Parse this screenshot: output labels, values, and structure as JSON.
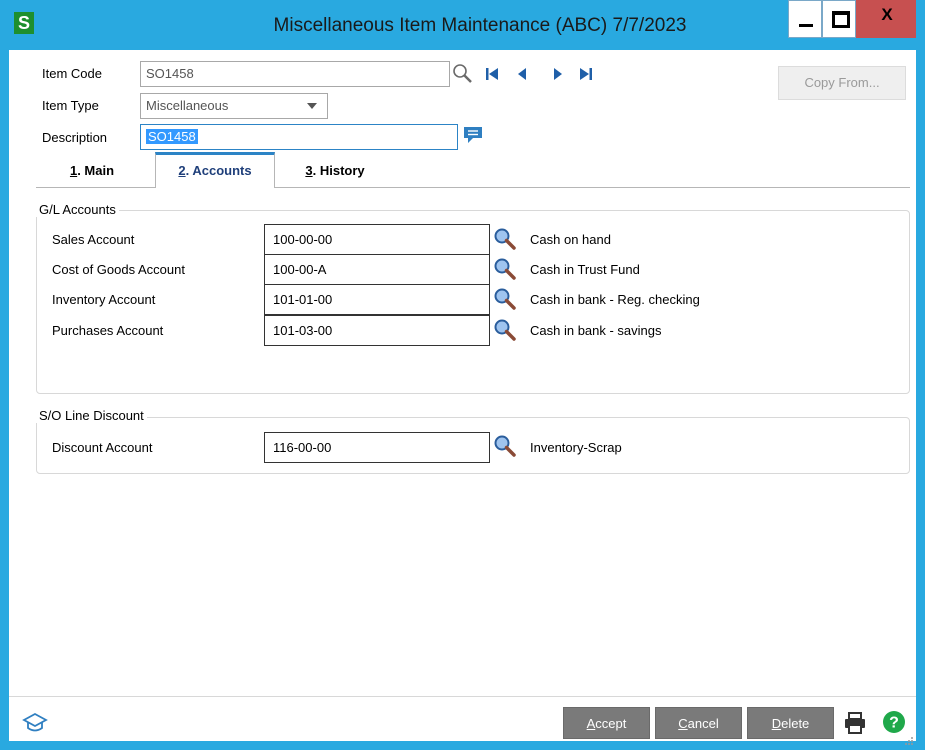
{
  "window": {
    "app_icon": "S",
    "title": "Miscellaneous Item Maintenance (ABC) 7/7/2023",
    "close_label": "X"
  },
  "header": {
    "item_code_label": "Item Code",
    "item_code_value": "SO1458",
    "item_type_label": "Item Type",
    "item_type_value": "Miscellaneous",
    "description_label": "Description",
    "description_value": "SO1458",
    "copy_from_label": "Copy From..."
  },
  "tabs": [
    {
      "num": "1",
      "label": ". Main"
    },
    {
      "num": "2",
      "label": ". Accounts"
    },
    {
      "num": "3",
      "label": ". History"
    }
  ],
  "gl_accounts": {
    "title": "G/L Accounts",
    "rows": [
      {
        "label": "Sales Account",
        "value": "100-00-00",
        "desc": "Cash on hand"
      },
      {
        "label": "Cost of Goods Account",
        "value": "100-00-A",
        "desc": "Cash in Trust Fund"
      },
      {
        "label": "Inventory Account",
        "value": "101-01-00",
        "desc": "Cash in bank - Reg. checking"
      },
      {
        "label": "Purchases Account",
        "value": "101-03-00",
        "desc": "Cash in bank - savings"
      }
    ]
  },
  "so_discount": {
    "title": "S/O Line Discount",
    "label": "Discount Account",
    "value": "116-00-00",
    "desc": "Inventory-Scrap"
  },
  "footer": {
    "accept_first": "A",
    "accept_rest": "ccept",
    "cancel_first": "C",
    "cancel_rest": "ancel",
    "delete_first": "D",
    "delete_rest": "elete"
  },
  "colors": {
    "titlebar": "#29a9e0",
    "close_button": "#c75050",
    "selection": "#3399ff",
    "footer_button": "#7a7a7a"
  }
}
